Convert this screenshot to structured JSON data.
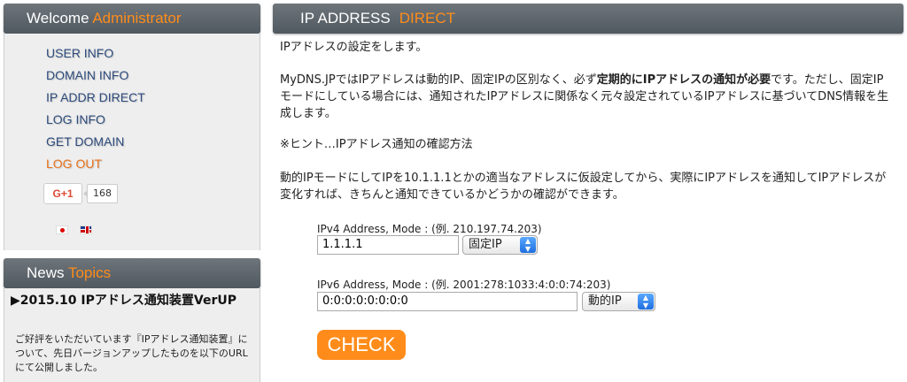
{
  "sidebar": {
    "welcome_prefix": "Welcome",
    "welcome_accent": "Administrator",
    "menu": [
      "USER INFO",
      "DOMAIN INFO",
      "IP ADDR DIRECT",
      "LOG INFO",
      "GET DOMAIN",
      "LOG OUT"
    ],
    "gplus_label": "G+1",
    "gplus_count": "168",
    "news_prefix": "News",
    "news_accent": "Topics",
    "news_title": "▶2015.10 IPアドレス通知装置VerUP",
    "news_body": "ご好評をいただいています『IPアドレス通知装置』について、先日バージョンアップしたものを以下のURLにて公開しました。"
  },
  "main": {
    "title_prefix": "IP ADDRESS",
    "title_accent": "DIRECT",
    "p1": "IPアドレスの設定をします。",
    "p2_before": "MyDNS.JPではIPアドレスは動的IP、固定IPの区別なく、必ず",
    "p2_bold": "定期的にIPアドレスの通知が必要",
    "p2_after": "です。ただし、固定IPモードにしている場合には、通知されたIPアドレスに関係なく元々設定されているIPアドレスに基づいてDNS情報を生成します。",
    "p3": "※ヒント…IPアドレス通知の確認方法",
    "p4": "動的IPモードにしてIPを10.1.1.1とかの適当なアドレスに仮設定してから、実際にIPアドレスを通知してIPアドレスが変化すれば、きちんと通知できているかどうかの確認ができます。",
    "ipv4_label": "IPv4 Address, Mode : (例. 210.197.74.203)",
    "ipv4_value": "1.1.1.1",
    "ipv4_mode": "固定IP",
    "ipv6_label": "IPv6 Address, Mode : (例. 2001:278:1033:4:0:0:74:203)",
    "ipv6_value": "0:0:0:0:0:0:0:0",
    "ipv6_mode": "動的IP",
    "check_label": "CHECK"
  },
  "colors": {
    "accent": "#ff8c1a",
    "menu": "#2d4b7c",
    "header": "#5a6168"
  }
}
